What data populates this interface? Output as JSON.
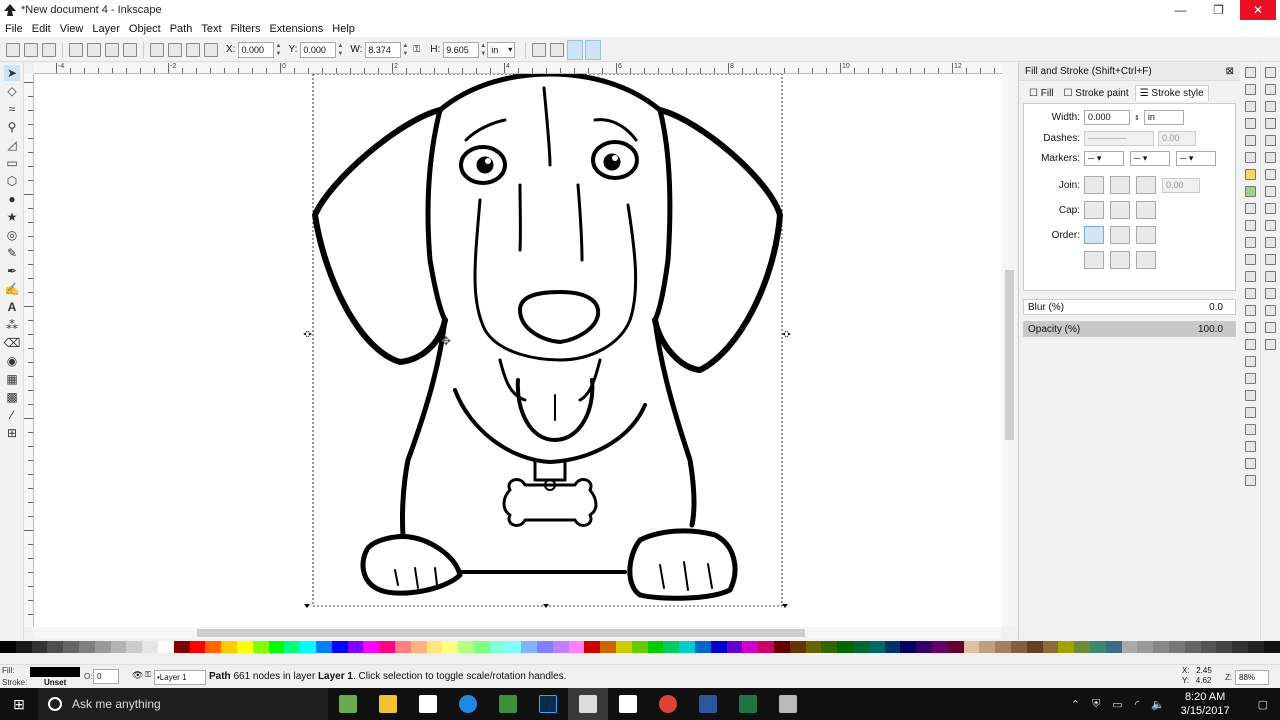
{
  "window": {
    "title": "*New document 4 - Inkscape",
    "minimize": "—",
    "maximize": "❐",
    "close": "✕"
  },
  "menu": [
    "File",
    "Edit",
    "View",
    "Layer",
    "Object",
    "Path",
    "Text",
    "Filters",
    "Extensions",
    "Help"
  ],
  "toolcontrols": {
    "x_label": "X:",
    "x_value": "0.000",
    "y_label": "Y:",
    "y_value": "0.000",
    "w_label": "W:",
    "w_value": "8.374",
    "h_label": "H:",
    "h_value": "9.605",
    "unit": "in"
  },
  "ruler": {
    "h_labels": [
      "-4",
      "-2",
      "0",
      "2",
      "4",
      "6",
      "8",
      "10",
      "12"
    ]
  },
  "dock": {
    "title": "Fill and Stroke (Shift+Ctrl+F)",
    "tabs": [
      "Fill",
      "Stroke paint",
      "Stroke style"
    ],
    "width_label": "Width:",
    "width_value": "0.000",
    "width_unit": "in",
    "dashes_label": "Dashes:",
    "dashes_value": "0.00",
    "markers_label": "Markers:",
    "join_label": "Join:",
    "join_value": "0.00",
    "cap_label": "Cap:",
    "order_label": "Order:",
    "blur_label": "Blur (%)",
    "blur_value": "0.0",
    "opacity_label": "Opacity (%)",
    "opacity_value": "100.0"
  },
  "status": {
    "fill_label": "Fill:",
    "stroke_label": "Stroke:",
    "stroke_value": "Unset",
    "opacity_label": "O:",
    "opacity_value": "0",
    "layer": "•Layer 1",
    "message_bold1": "Path",
    "message_part1": " 661 nodes in layer ",
    "message_bold2": "Layer 1",
    "message_part2": ". Click selection to toggle scale/rotation handles.",
    "x_label": "X:",
    "x_value": "2.45",
    "y_label": "Y:",
    "y_value": "4.62",
    "zoom_label": "Z:",
    "zoom_value": "88%"
  },
  "taskbar": {
    "search_placeholder": "Ask me anything",
    "time": "8:20 AM",
    "date": "3/15/2017"
  },
  "colors": {
    "accent": "#0078d7",
    "close": "#e81123",
    "selected": "#cde4f8"
  }
}
